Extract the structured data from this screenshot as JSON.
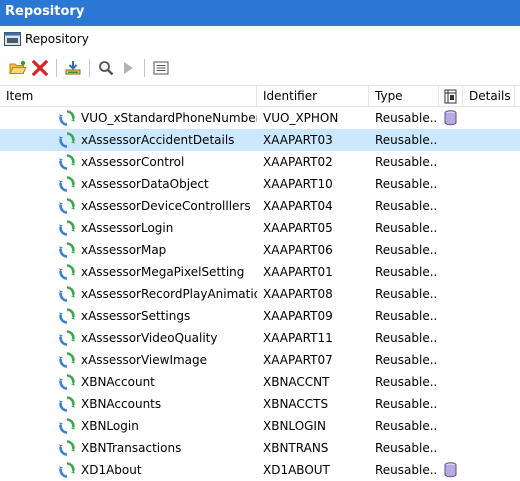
{
  "window": {
    "title": "Repository"
  },
  "breadcrumb": {
    "label": "Repository",
    "icon": "repository-window-icon"
  },
  "toolbar": {
    "buttons": [
      {
        "name": "open-folder-button",
        "icon": "folder-open-icon"
      },
      {
        "name": "delete-button",
        "icon": "delete-x-icon"
      },
      {
        "name": "download-button",
        "icon": "download-icon"
      },
      {
        "name": "search-button",
        "icon": "search-icon"
      },
      {
        "name": "run-button",
        "icon": "play-icon"
      },
      {
        "name": "properties-button",
        "icon": "list-icon"
      }
    ]
  },
  "columns": {
    "item": "Item",
    "identifier": "Identifier",
    "type": "Type",
    "details": "Details"
  },
  "colors": {
    "titlebar": "#2b78d4",
    "selection": "#cce8ff",
    "delete_red": "#e02020"
  },
  "rows": [
    {
      "name": "VUO_xStandardPhoneNumber",
      "id": "VUO_XPHON",
      "type": "Reusable...",
      "cylinder": true,
      "selected": false
    },
    {
      "name": "xAssessorAccidentDetails",
      "id": "XAAPART03",
      "type": "Reusable...",
      "cylinder": false,
      "selected": true
    },
    {
      "name": "xAssessorControl",
      "id": "XAAPART02",
      "type": "Reusable...",
      "cylinder": false,
      "selected": false
    },
    {
      "name": "xAssessorDataObject",
      "id": "XAAPART10",
      "type": "Reusable...",
      "cylinder": false,
      "selected": false
    },
    {
      "name": "xAssessorDeviceControlllers",
      "id": "XAAPART04",
      "type": "Reusable...",
      "cylinder": false,
      "selected": false
    },
    {
      "name": "xAssessorLogin",
      "id": "XAAPART05",
      "type": "Reusable...",
      "cylinder": false,
      "selected": false
    },
    {
      "name": "xAssessorMap",
      "id": "XAAPART06",
      "type": "Reusable...",
      "cylinder": false,
      "selected": false
    },
    {
      "name": "xAssessorMegaPixelSetting",
      "id": "XAAPART01",
      "type": "Reusable...",
      "cylinder": false,
      "selected": false
    },
    {
      "name": "xAssessorRecordPlayAnimation",
      "id": "XAAPART08",
      "type": "Reusable...",
      "cylinder": false,
      "selected": false
    },
    {
      "name": "xAssessorSettings",
      "id": "XAAPART09",
      "type": "Reusable...",
      "cylinder": false,
      "selected": false
    },
    {
      "name": "xAssessorVideoQuality",
      "id": "XAAPART11",
      "type": "Reusable...",
      "cylinder": false,
      "selected": false
    },
    {
      "name": "xAssessorViewImage",
      "id": "XAAPART07",
      "type": "Reusable...",
      "cylinder": false,
      "selected": false
    },
    {
      "name": "XBNAccount",
      "id": "XBNACCNT",
      "type": "Reusable...",
      "cylinder": false,
      "selected": false
    },
    {
      "name": "XBNAccounts",
      "id": "XBNACCTS",
      "type": "Reusable...",
      "cylinder": false,
      "selected": false
    },
    {
      "name": "XBNLogin",
      "id": "XBNLOGIN",
      "type": "Reusable...",
      "cylinder": false,
      "selected": false
    },
    {
      "name": "XBNTransactions",
      "id": "XBNTRANS",
      "type": "Reusable...",
      "cylinder": false,
      "selected": false
    },
    {
      "name": "XD1About",
      "id": "XD1ABOUT",
      "type": "Reusable...",
      "cylinder": true,
      "selected": false
    }
  ]
}
